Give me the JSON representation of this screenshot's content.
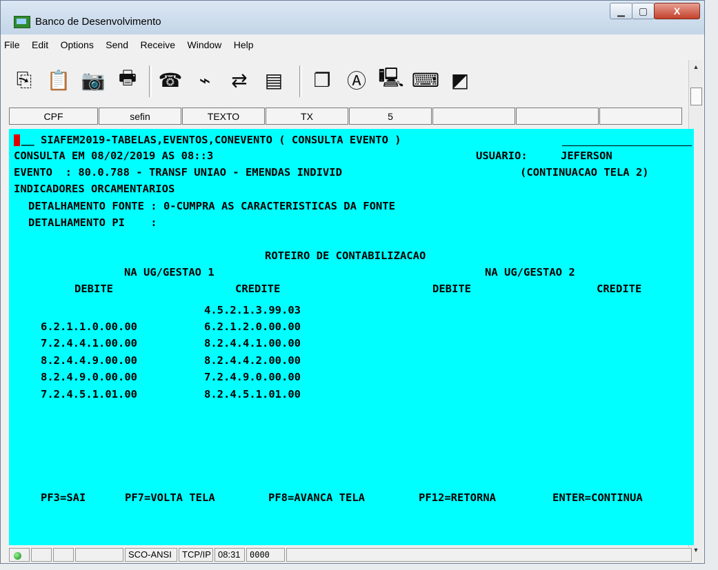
{
  "window": {
    "title": "Banco de Desenvolvimento",
    "min_glyph": "▁",
    "max_glyph": "▢",
    "close_glyph": "X"
  },
  "menu": [
    "File",
    "Edit",
    "Options",
    "Send",
    "Receive",
    "Window",
    "Help"
  ],
  "toolbar": [
    "copy-icon",
    "paste-icon",
    "camera-icon",
    "printer-icon",
    "phone-icon",
    "plug-icon",
    "transfer-icon",
    "file-layout-icon",
    "stack-icon",
    "spellcheck-icon",
    "computer-icon",
    "keyboard-icon",
    "macro-icon"
  ],
  "fkeys": [
    "CPF",
    "sefin",
    "TEXTO",
    "TX",
    "5",
    "",
    "",
    ""
  ],
  "terminal": {
    "bg_color": "#00ffff",
    "header": "__ SIAFEM2019-TABELAS,EVENTOS,CONEVENTO ( CONSULTA EVENTO )",
    "consulta": "CONSULTA EM 08/02/2019 AS 08::3",
    "usuario_label": "USUARIO:",
    "usuario": "JEFERSON",
    "evento_line": "EVENTO  : 80.0.788 - TRANSF UNIAO - EMENDAS INDIVID",
    "continuacao": "(CONTINUACAO TELA 2)",
    "indicadores": "INDICADORES ORCAMENTARIOS",
    "det_fonte": "DETALHAMENTO FONTE : 0-CUMPRA AS CARACTERISTICAS DA FONTE",
    "det_pi": "DETALHAMENTO PI    :",
    "roteiro": "ROTEIRO DE CONTABILIZACAO",
    "ug1": "NA UG/GESTAO 1",
    "ug2": "NA UG/GESTAO 2",
    "debite1": "DEBITE",
    "credite1": "CREDITE",
    "debite2": "DEBITE",
    "credite2": "CREDITE",
    "rows": [
      {
        "debite": "",
        "credite": "4.5.2.1.3.99.03"
      },
      {
        "debite": "6.2.1.1.0.00.00",
        "credite": "6.2.1.2.0.00.00"
      },
      {
        "debite": "7.2.4.4.1.00.00",
        "credite": "8.2.4.4.1.00.00"
      },
      {
        "debite": "8.2.4.4.9.00.00",
        "credite": "8.2.4.4.2.00.00"
      },
      {
        "debite": "8.2.4.9.0.00.00",
        "credite": "7.2.4.9.0.00.00"
      },
      {
        "debite": "7.2.4.5.1.01.00",
        "credite": "8.2.4.5.1.01.00"
      }
    ],
    "pf3": "PF3=SAI",
    "pf7": "PF7=VOLTA TELA",
    "pf8": "PF8=AVANCA TELA",
    "pf12": "PF12=RETORNA",
    "enter": "ENTER=CONTINUA"
  },
  "status": {
    "protocol": "SCO-ANSI",
    "conn": "TCP/IP",
    "time": "08:31",
    "session": "0000"
  }
}
